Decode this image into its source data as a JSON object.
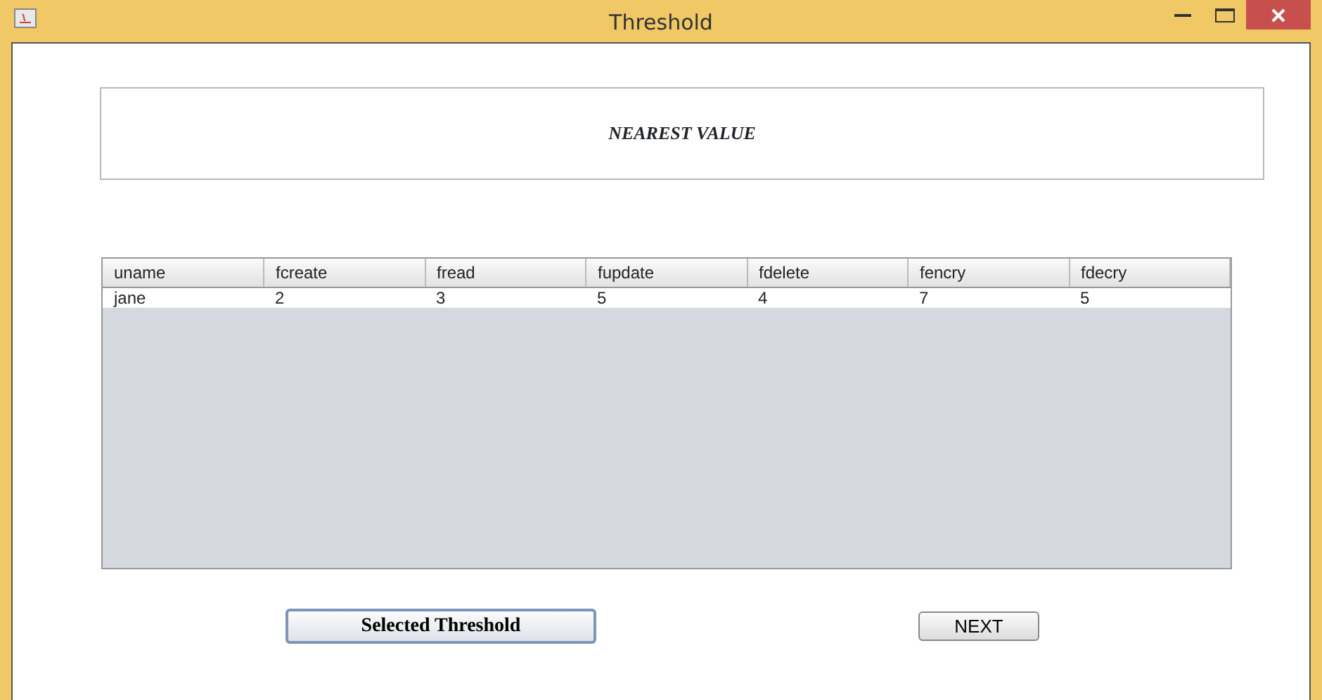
{
  "window": {
    "title": "Threshold"
  },
  "heading": "NEAREST VALUE",
  "table": {
    "columns": [
      "uname",
      "fcreate",
      "fread",
      "fupdate",
      "fdelete",
      "fencry",
      "fdecry"
    ],
    "rows": [
      [
        "jane",
        "2",
        "3",
        "5",
        "4",
        "7",
        "5"
      ]
    ]
  },
  "buttons": [
    {
      "label": "Selected Threshold",
      "kind": "bold"
    },
    {
      "label": "NEXT",
      "kind": "plain"
    }
  ]
}
